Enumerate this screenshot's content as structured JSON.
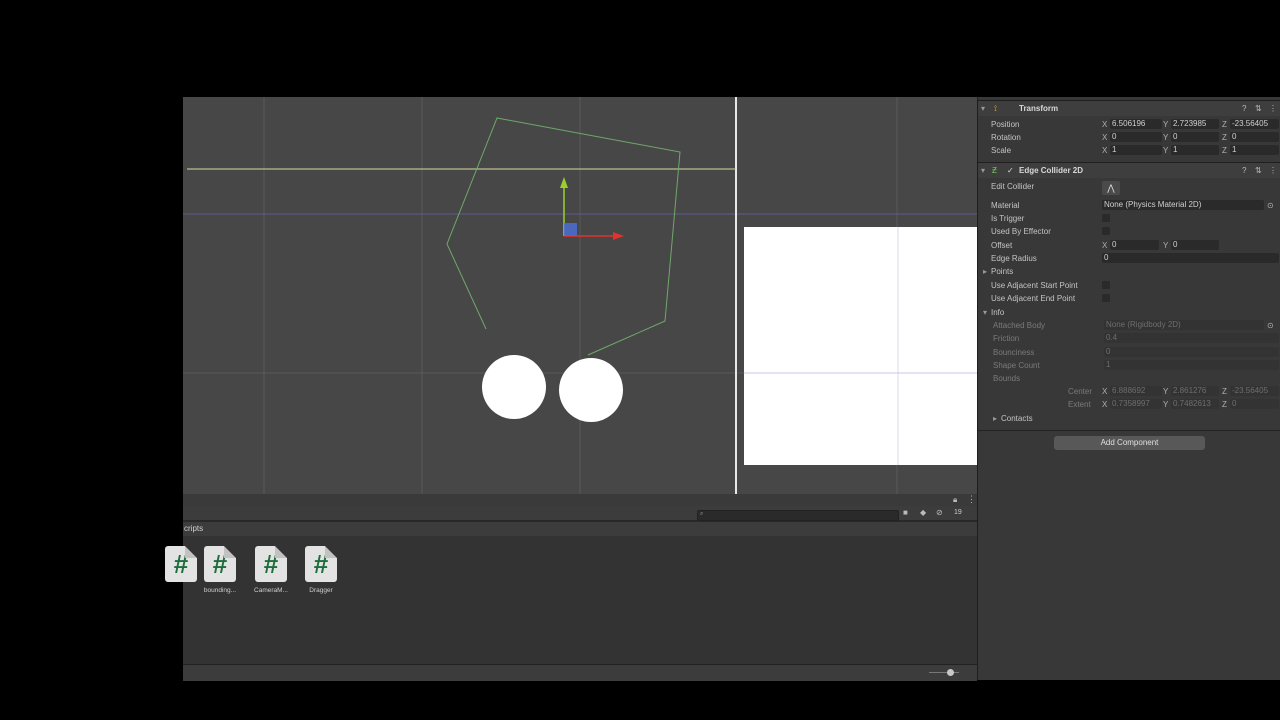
{
  "scene": {
    "grid": "on",
    "selected": "edge-collider-polyline"
  },
  "project": {
    "breadcrumb": "cripts",
    "count": "19",
    "assets": [
      {
        "name": ""
      },
      {
        "name": "bounding..."
      },
      {
        "name": "CameraM..."
      },
      {
        "name": "Dragger"
      }
    ],
    "asset_glyph": "#"
  },
  "inspector": {
    "transform": {
      "title": "Transform",
      "position_label": "Position",
      "rotation_label": "Rotation",
      "scale_label": "Scale",
      "position": {
        "x": "6.506196",
        "y": "2.723985",
        "z": "-23.56405"
      },
      "rotation": {
        "x": "0",
        "y": "0",
        "z": "0"
      },
      "scale": {
        "x": "1",
        "y": "1",
        "z": "1"
      }
    },
    "edge_collider": {
      "title": "Edge Collider 2D",
      "edit_collider": "Edit Collider",
      "material_label": "Material",
      "material_value": "None (Physics Material 2D)",
      "is_trigger": "Is Trigger",
      "used_by_effector": "Used By Effector",
      "offset_label": "Offset",
      "offset": {
        "x": "0",
        "y": "0"
      },
      "edge_radius_label": "Edge Radius",
      "edge_radius": "0",
      "points": "Points",
      "use_adj_start": "Use Adjacent Start Point",
      "use_adj_end": "Use Adjacent End Point",
      "info": "Info",
      "attached_body_label": "Attached Body",
      "attached_body": "None (Rigidbody 2D)",
      "friction_label": "Friction",
      "friction": "0.4",
      "bounciness_label": "Bounciness",
      "bounciness": "0",
      "shape_count_label": "Shape Count",
      "shape_count": "1",
      "bounds_label": "Bounds",
      "center_label": "Center",
      "center": {
        "x": "6.888692",
        "y": "2.861276",
        "z": "-23.56405"
      },
      "extent_label": "Extent",
      "extent": {
        "x": "0.7358997",
        "y": "0.7482613",
        "z": "0"
      },
      "contacts": "Contacts"
    },
    "add_component": "Add Component",
    "axis_x": "X",
    "axis_y": "Y",
    "axis_z": "Z"
  },
  "colors": {
    "collider": "#6fa86a",
    "gizmo_y": "#9ad02c",
    "gizmo_x": "#e0332c",
    "panel": "#383838"
  }
}
